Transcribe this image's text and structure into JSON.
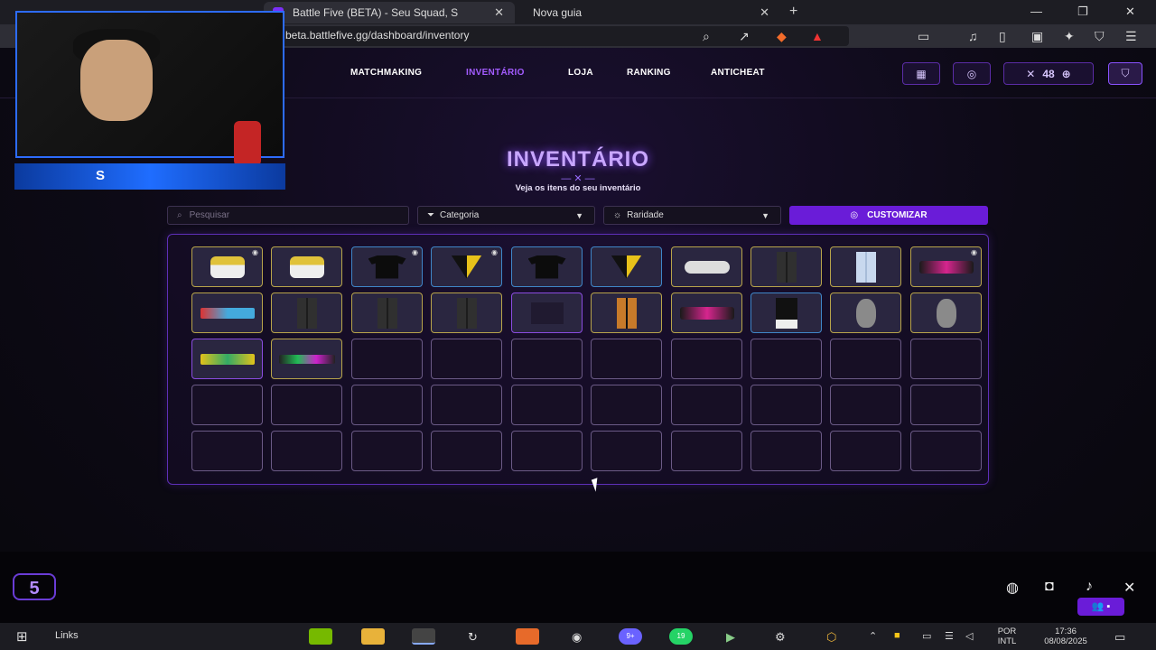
{
  "browser": {
    "active_tab": "Battle Five (BETA) - Seu Squad, S",
    "second_tab": "Nova guia",
    "url": "beta.battlefive.gg/dashboard/inventory"
  },
  "nav": {
    "links": [
      "MATCHMAKING",
      "INVENTÁRIO",
      "LOJA",
      "RANKING",
      "ANTICHEAT"
    ],
    "coins": "48"
  },
  "inventory": {
    "title": "INVENTÁRIO",
    "subtitle": "Veja os itens do seu inventário",
    "search_placeholder": "Pesquisar",
    "category": "Categoria",
    "rarity": "Raridade",
    "customize": "CUSTOMIZAR"
  },
  "taskbar": {
    "links": "Links",
    "lang1": "POR",
    "lang2": "INTL",
    "time": "17:36",
    "date": "08/08/2025",
    "whatsapp_badge": "19",
    "messenger_badge": "9+"
  }
}
